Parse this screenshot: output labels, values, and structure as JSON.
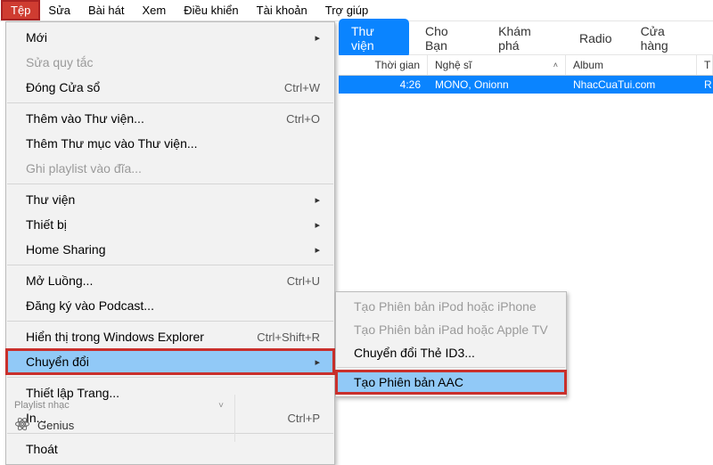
{
  "menubar": {
    "items": [
      {
        "label": "Tệp",
        "active": true
      },
      {
        "label": "Sửa"
      },
      {
        "label": "Bài hát"
      },
      {
        "label": "Xem"
      },
      {
        "label": "Điều khiển"
      },
      {
        "label": "Tài khoản"
      },
      {
        "label": "Trợ giúp"
      }
    ]
  },
  "tabs": {
    "items": [
      {
        "label": "Thư viện",
        "active": true
      },
      {
        "label": "Cho Bạn"
      },
      {
        "label": "Khám phá"
      },
      {
        "label": "Radio"
      },
      {
        "label": "Cửa hàng"
      }
    ]
  },
  "table": {
    "headers": {
      "duration": "Thời gian",
      "artist": "Nghệ sĩ",
      "album": "Album",
      "last": "T"
    },
    "rows": [
      {
        "duration": "4:26",
        "artist": "MONO, Onionn",
        "album": "NhacCuaTui.com",
        "last": "R"
      }
    ]
  },
  "file_menu": {
    "new": "Mới",
    "edit_rules": "Sửa quy tắc",
    "close_window": "Đóng Cửa sổ",
    "close_window_sc": "Ctrl+W",
    "add_to_library": "Thêm vào Thư viện...",
    "add_to_library_sc": "Ctrl+O",
    "add_folder": "Thêm Thư mục vào Thư viện...",
    "burn": "Ghi playlist vào đĩa...",
    "library": "Thư viện",
    "devices": "Thiết bị",
    "home_sharing": "Home Sharing",
    "open_stream": "Mở Luồng...",
    "open_stream_sc": "Ctrl+U",
    "subscribe_podcast": "Đăng ký vào Podcast...",
    "show_explorer": "Hiển thị trong Windows Explorer",
    "show_explorer_sc": "Ctrl+Shift+R",
    "convert": "Chuyển đổi",
    "page_setup": "Thiết lập Trang...",
    "print": "In...",
    "print_sc": "Ctrl+P",
    "exit": "Thoát"
  },
  "convert_submenu": {
    "ipod": "Tạo Phiên bản iPod hoặc iPhone",
    "ipad": "Tạo Phiên bản iPad hoặc Apple TV",
    "id3": "Chuyển đổi Thẻ ID3...",
    "aac": "Tạo Phiên bản AAC"
  },
  "sidebar": {
    "section": "Playlist nhạc",
    "genius": "Genius"
  },
  "glyphs": {
    "right_arrow": "▸",
    "up_caret": "˄",
    "down_chev": "˅"
  }
}
